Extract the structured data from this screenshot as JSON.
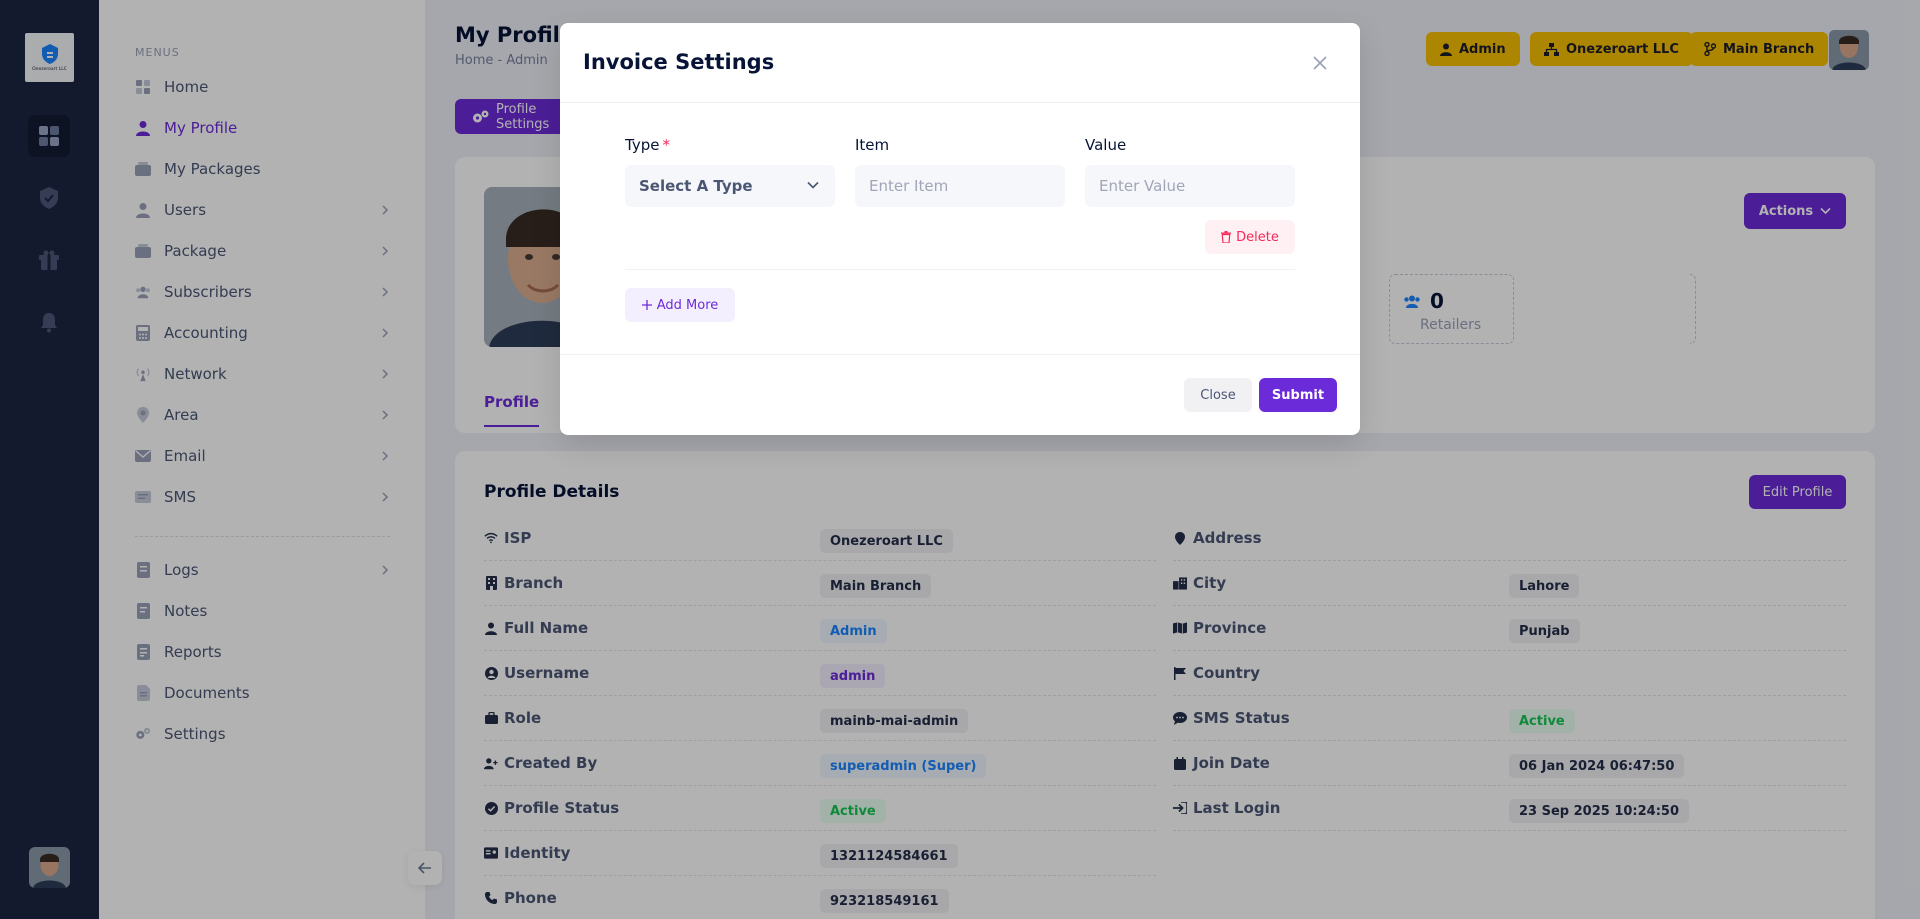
{
  "brand": {
    "logo_text": "Onezeroart LLC"
  },
  "menu": {
    "section_title": "MENUS",
    "items_top": [
      {
        "label": "Home"
      },
      {
        "label": "My Profile"
      },
      {
        "label": "My Packages"
      },
      {
        "label": "Users"
      },
      {
        "label": "Package"
      },
      {
        "label": "Subscribers"
      },
      {
        "label": "Accounting"
      },
      {
        "label": "Network"
      },
      {
        "label": "Area"
      },
      {
        "label": "Email"
      },
      {
        "label": "SMS"
      }
    ],
    "items_bottom": [
      {
        "label": "Logs"
      },
      {
        "label": "Notes"
      },
      {
        "label": "Reports"
      },
      {
        "label": "Documents"
      },
      {
        "label": "Settings"
      }
    ]
  },
  "header": {
    "title": "My Profile",
    "breadcrumb": "Home  -  Admin",
    "badges": [
      "Admin",
      "Onezeroart LLC",
      "Main Branch"
    ]
  },
  "toolbar": {
    "profile_settings_label": "Profile Settings"
  },
  "profile_card": {
    "actions_label": "Actions",
    "retailers_count": "0",
    "retailers_label": "Retailers",
    "tab_label": "Profile"
  },
  "details": {
    "title": "Profile Details",
    "edit_label": "Edit Profile",
    "left": [
      {
        "label": "ISP",
        "value": "Onezeroart LLC"
      },
      {
        "label": "Branch",
        "value": "Main Branch"
      },
      {
        "label": "Full Name",
        "value": "Admin"
      },
      {
        "label": "Username",
        "value": "admin"
      },
      {
        "label": "Role",
        "value": "mainb-mai-admin"
      },
      {
        "label": "Created By",
        "value": "superadmin (Super)"
      },
      {
        "label": "Profile Status",
        "value": "Active"
      },
      {
        "label": "Identity",
        "value": "1321124584661"
      },
      {
        "label": "Phone",
        "value": "923218549161"
      }
    ],
    "right": [
      {
        "label": "Address",
        "value": ""
      },
      {
        "label": "City",
        "value": "Lahore"
      },
      {
        "label": "Province",
        "value": "Punjab"
      },
      {
        "label": "Country",
        "value": ""
      },
      {
        "label": "SMS Status",
        "value": "Active"
      },
      {
        "label": "Join Date",
        "value": "06 Jan 2024 06:47:50"
      },
      {
        "label": "Last Login",
        "value": "23 Sep 2025 10:24:50"
      }
    ]
  },
  "modal": {
    "title": "Invoice Settings",
    "type_label": "Type",
    "required_mark": "*",
    "type_value": "Select A Type",
    "item_label": "Item",
    "item_placeholder": "Enter Item",
    "value_label": "Value",
    "value_placeholder": "Enter Value",
    "delete_label": "Delete",
    "add_more_label": "Add More",
    "close_label": "Close",
    "submit_label": "Submit"
  },
  "colors": {
    "primary": "#6c2bd9",
    "rail": "#1c2641",
    "badge_yellow": "#f6c000",
    "danger": "#f8285a",
    "success": "#17c653"
  }
}
